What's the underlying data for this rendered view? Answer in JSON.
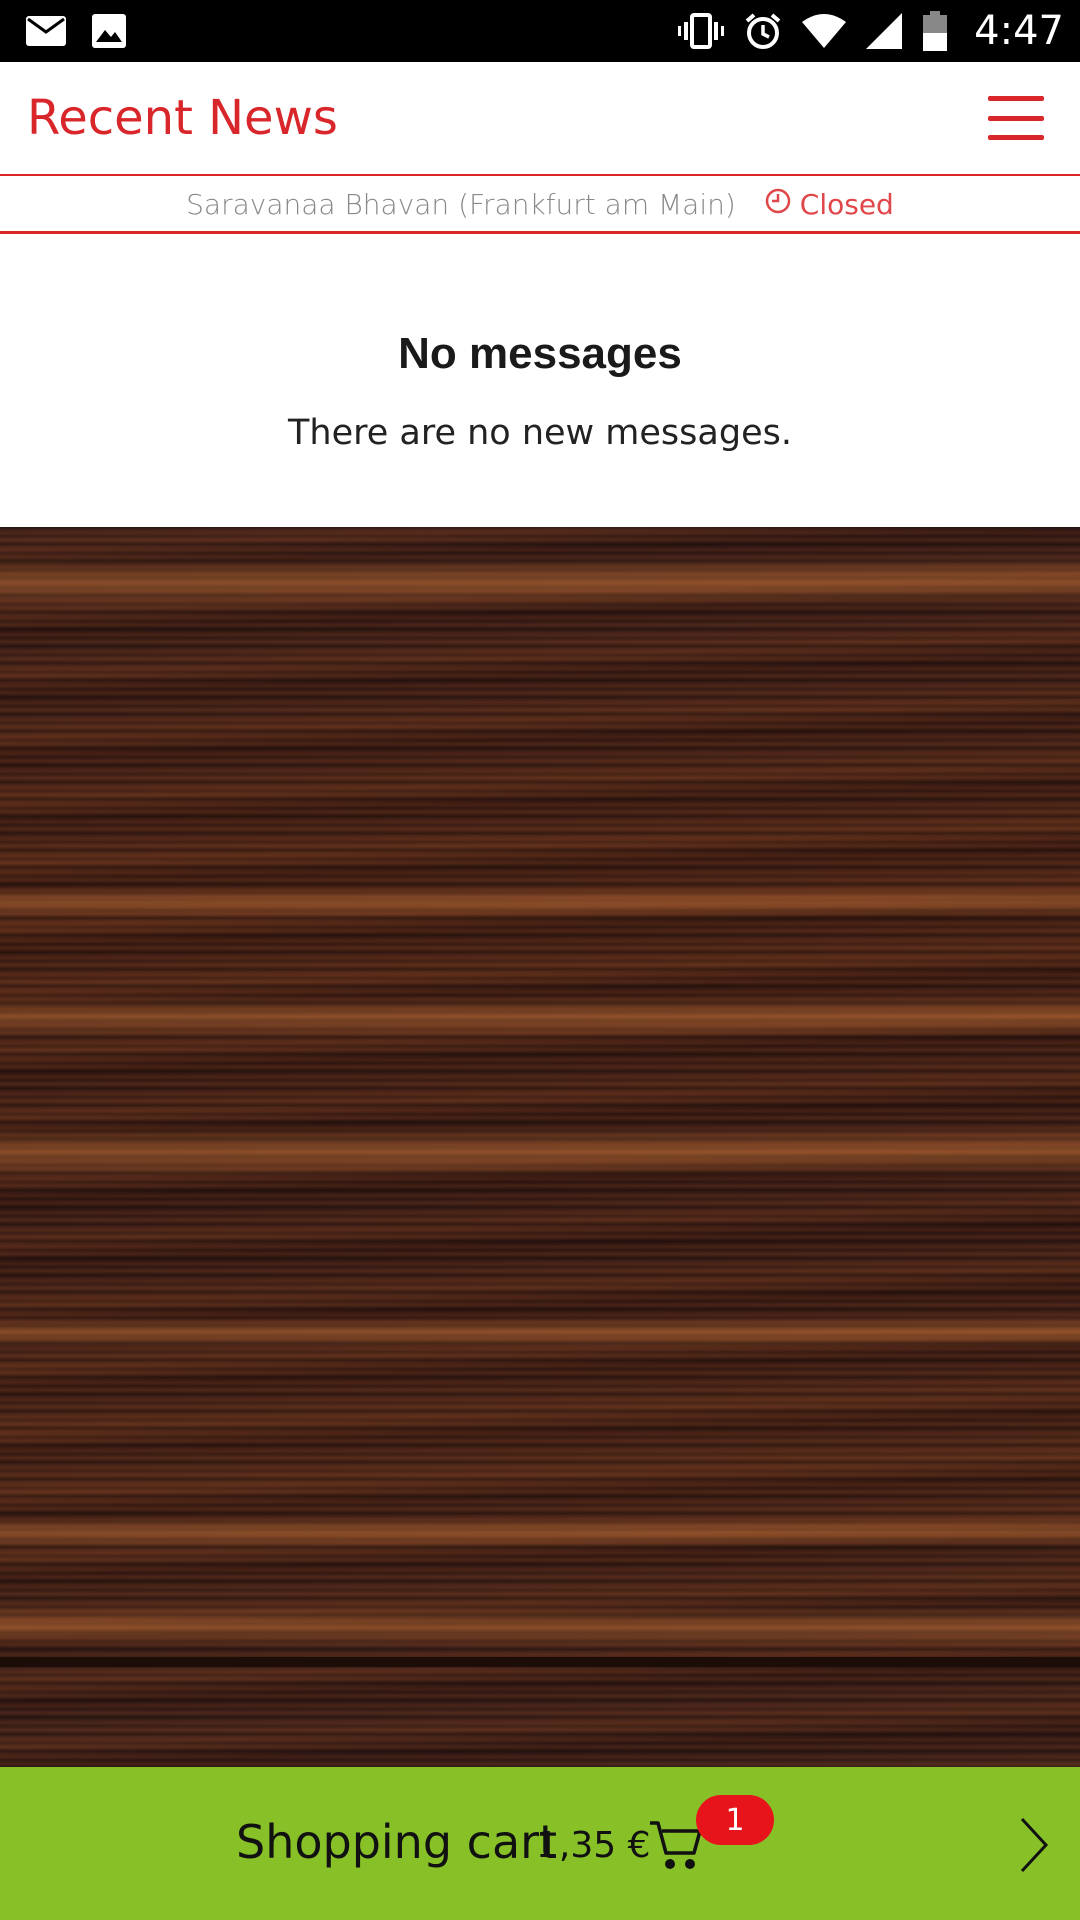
{
  "status_bar": {
    "time": "4:47",
    "icons": [
      "mail-icon",
      "image-icon",
      "vibrate-icon",
      "alarm-icon",
      "wifi-icon",
      "signal-icon",
      "battery-icon"
    ]
  },
  "header": {
    "title": "Recent News",
    "menu_icon": "hamburger-menu-icon",
    "accent_color": "#d8262a"
  },
  "restaurant": {
    "name": "Saravanaa Bhavan (Frankfurt am Main)",
    "status": "Closed",
    "status_icon": "clock-icon"
  },
  "messages": {
    "title": "No messages",
    "subtitle": "There are no new messages."
  },
  "cart": {
    "label": "Shopping cart",
    "total": "1,35 €",
    "count": "1",
    "icon": "shopping-cart-icon",
    "arrow_icon": "chevron-right-icon",
    "bar_color": "#87c127",
    "badge_color": "#e8141c"
  }
}
